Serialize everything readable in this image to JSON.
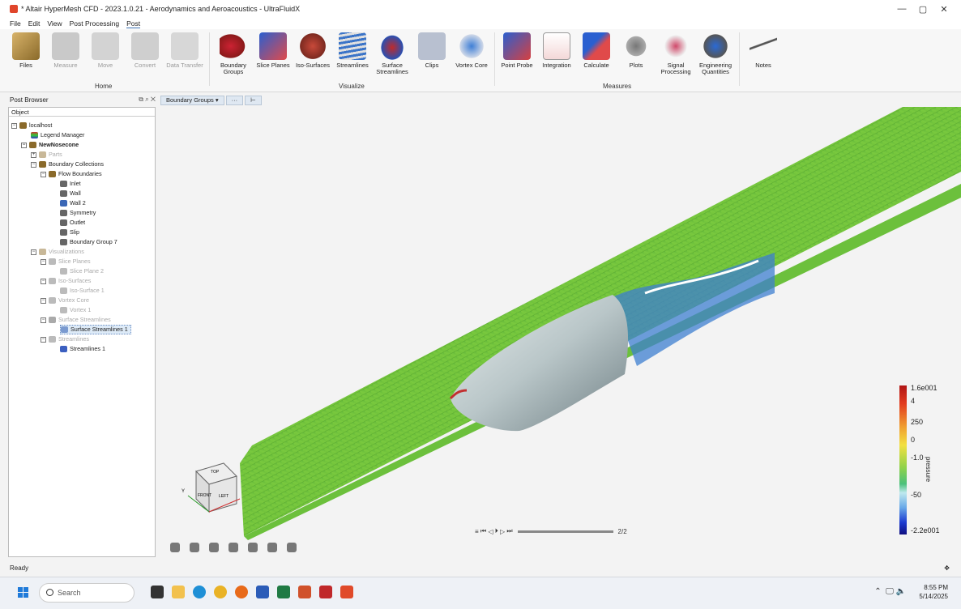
{
  "window": {
    "title": "* Altair HyperMesh CFD - 2023.1.0.21 - Aerodynamics and Aeroacoustics - UltraFluidX",
    "controls": [
      "—",
      "▢",
      "✕"
    ]
  },
  "menu": [
    "File",
    "Edit",
    "View",
    "Post Processing",
    "Post"
  ],
  "ribbon": {
    "home": {
      "label": "Home",
      "items": [
        "Files",
        "Measure",
        "Move",
        "Convert",
        "Data Transfer"
      ]
    },
    "visualize": {
      "label": "Visualize",
      "items": [
        "Boundary Groups",
        "Slice Planes",
        "Iso-Surfaces",
        "Streamlines",
        "Surface Streamlines",
        "Clips",
        "Vortex Core"
      ]
    },
    "measures": {
      "label": "Measures",
      "items": [
        "Point Probe",
        "Integration",
        "Calculate",
        "Plots",
        "Signal Processing",
        "Engineering Quantities"
      ]
    },
    "notes": "Notes"
  },
  "browser": {
    "title": "Post Browser",
    "column": "Object",
    "nodes": [
      {
        "label": "localhost"
      },
      {
        "label": "Legend Manager"
      },
      {
        "label": "NewNosecone"
      },
      {
        "label": "Parts"
      },
      {
        "label": "Boundary Collections"
      },
      {
        "label": "Flow Boundaries"
      },
      {
        "label": "Inlet"
      },
      {
        "label": "Wall"
      },
      {
        "label": "Wall 2"
      },
      {
        "label": "Symmetry"
      },
      {
        "label": "Outlet"
      },
      {
        "label": "Slip"
      },
      {
        "label": "Boundary Group 7"
      },
      {
        "label": "Visualizations"
      },
      {
        "label": "Slice Planes"
      },
      {
        "label": "Slice Plane 2"
      },
      {
        "label": "Iso-Surfaces"
      },
      {
        "label": "Iso-Surface 1"
      },
      {
        "label": "Vortex Core"
      },
      {
        "label": "Vortex 1"
      },
      {
        "label": "Surface Streamlines"
      },
      {
        "label": "Surface Streamlines 1"
      },
      {
        "label": "Streamlines"
      },
      {
        "label": "Streamlines 1"
      }
    ]
  },
  "viewport_tab": "Boundary Groups",
  "legend": {
    "ticks": [
      "1.6e001",
      "4",
      "250",
      "0",
      "-1.0",
      "-50",
      "-2.2e001"
    ],
    "quantity": "pressure",
    "colors": [
      "#b01515",
      "#f0a030",
      "#8fd24a",
      "#bfe9ee",
      "#1c3ad0",
      "#101080"
    ]
  },
  "playback": {
    "frame": "2/2"
  },
  "view_cube": {
    "faces": [
      "TOP",
      "FRONT",
      "LEFT"
    ],
    "axis_y": "Y"
  },
  "status": "Ready",
  "taskbar": {
    "search_placeholder": "Search",
    "time": "8:55 PM",
    "date": "5/14/2025"
  }
}
